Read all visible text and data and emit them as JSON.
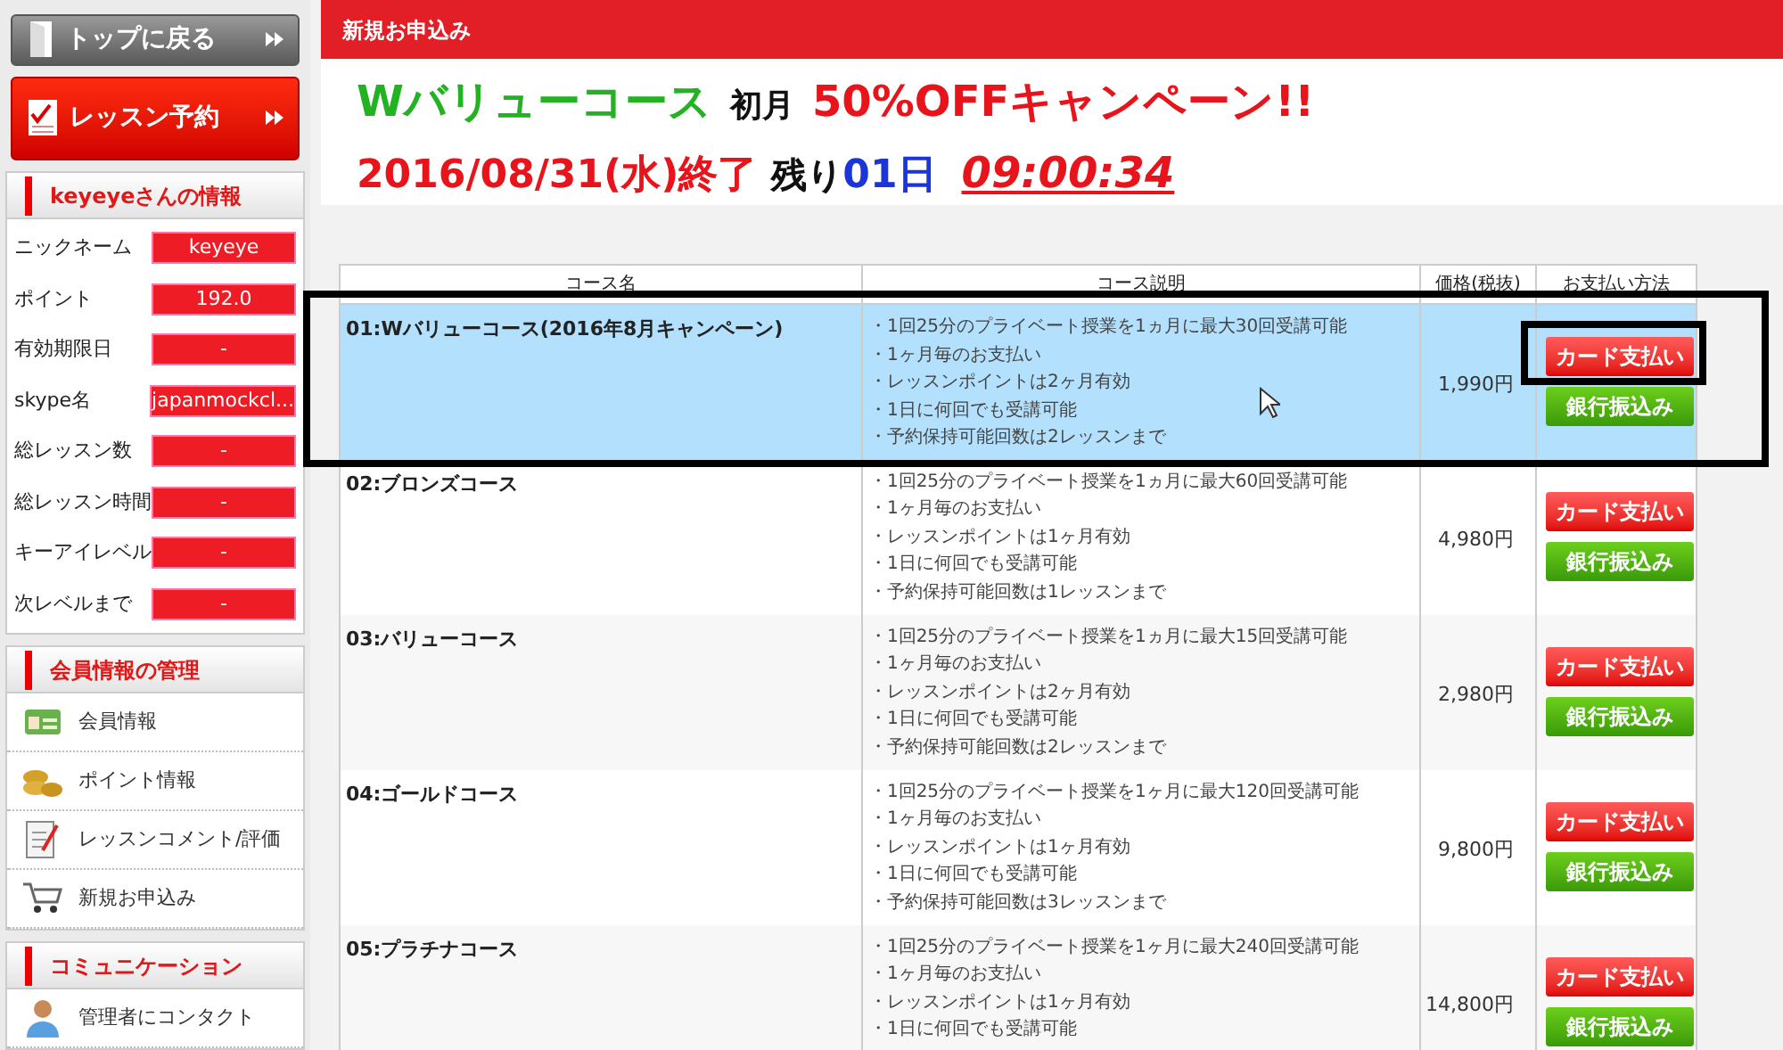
{
  "sidebar": {
    "nav_buttons": [
      {
        "label": "トップに戻る",
        "kind": "gray"
      },
      {
        "label": "レッスン予約",
        "kind": "red"
      }
    ],
    "info_section": {
      "title": "keyeyeさんの情報",
      "rows": [
        {
          "label": "ニックネーム",
          "value": "keyeye"
        },
        {
          "label": "ポイント",
          "value": "192.0"
        },
        {
          "label": "有効期限日",
          "value": "-"
        },
        {
          "label": "skype名",
          "value": "japanmockcl..."
        },
        {
          "label": "総レッスン数",
          "value": "-"
        },
        {
          "label": "総レッスン時間",
          "value": "-"
        },
        {
          "label": "キーアイレベル",
          "value": "-"
        },
        {
          "label": "次レベルまで",
          "value": "-"
        }
      ]
    },
    "menu_sections": [
      {
        "title": "会員情報の管理",
        "items": [
          {
            "label": "会員情報",
            "kind": "card"
          },
          {
            "label": "ポイント情報",
            "kind": "coins"
          },
          {
            "label": "レッスンコメント/評価",
            "kind": "clipboard"
          },
          {
            "label": "新規お申込み",
            "kind": "cart"
          }
        ]
      },
      {
        "title": "コミュニケーション",
        "items": [
          {
            "label": "管理者にコンタクト",
            "kind": "person"
          }
        ]
      }
    ]
  },
  "header": {
    "title": "新規お申込み"
  },
  "campaign": {
    "course": "Wバリューコース",
    "first_month": "初月",
    "offer": "50%OFFキャンペーン!!",
    "end_date": "2016/08/31(水)終了",
    "remaining_label": "残り",
    "remaining_days": "01日",
    "countdown": "09:00:34"
  },
  "table": {
    "columns": [
      "コース名",
      "コース説明",
      "価格(税抜)",
      "お支払い方法"
    ],
    "rows": [
      {
        "name": "01:Wバリューコース(2016年8月キャンペーン)",
        "selected": true,
        "price": "1,990円",
        "description": [
          "・1回25分のプライベート授業を1ヵ月に最大30回受講可能",
          "・1ヶ月毎のお支払い",
          "・レッスンポイントは2ヶ月有効",
          "・1日に何回でも受講可能",
          "・予約保持可能回数は2レッスンまで"
        ],
        "buttons": [
          "カード支払い",
          "銀行振込み"
        ]
      },
      {
        "name": "02:ブロンズコース",
        "selected": false,
        "price": "4,980円",
        "description": [
          "・1回25分のプライベート授業を1ヵ月に最大60回受講可能",
          "・1ヶ月毎のお支払い",
          "・レッスンポイントは1ヶ月有効",
          "・1日に何回でも受講可能",
          "・予約保持可能回数は1レッスンまで"
        ],
        "buttons": [
          "カード支払い",
          "銀行振込み"
        ]
      },
      {
        "name": "03:バリューコース",
        "selected": false,
        "price": "2,980円",
        "description": [
          "・1回25分のプライベート授業を1ヵ月に最大15回受講可能",
          "・1ヶ月毎のお支払い",
          "・レッスンポイントは2ヶ月有効",
          "・1日に何回でも受講可能",
          "・予約保持可能回数は2レッスンまで"
        ],
        "buttons": [
          "カード支払い",
          "銀行振込み"
        ]
      },
      {
        "name": "04:ゴールドコース",
        "selected": false,
        "price": "9,800円",
        "description": [
          "・1回25分のプライベート授業を1ヶ月に最大120回受講可能",
          "・1ヶ月毎のお支払い",
          "・レッスンポイントは1ヶ月有効",
          "・1日に何回でも受講可能",
          "・予約保持可能回数は3レッスンまで"
        ],
        "buttons": [
          "カード支払い",
          "銀行振込み"
        ]
      },
      {
        "name": "05:プラチナコース",
        "selected": false,
        "price": "14,800円",
        "description": [
          "・1回25分のプライベート授業を1ヶ月に最大240回受講可能",
          "・1ヶ月毎のお支払い",
          "・レッスンポイントは1ヶ月有効",
          "・1日に何回でも受講可能"
        ],
        "buttons": [
          "カード支払い",
          "銀行振込み"
        ]
      }
    ]
  }
}
